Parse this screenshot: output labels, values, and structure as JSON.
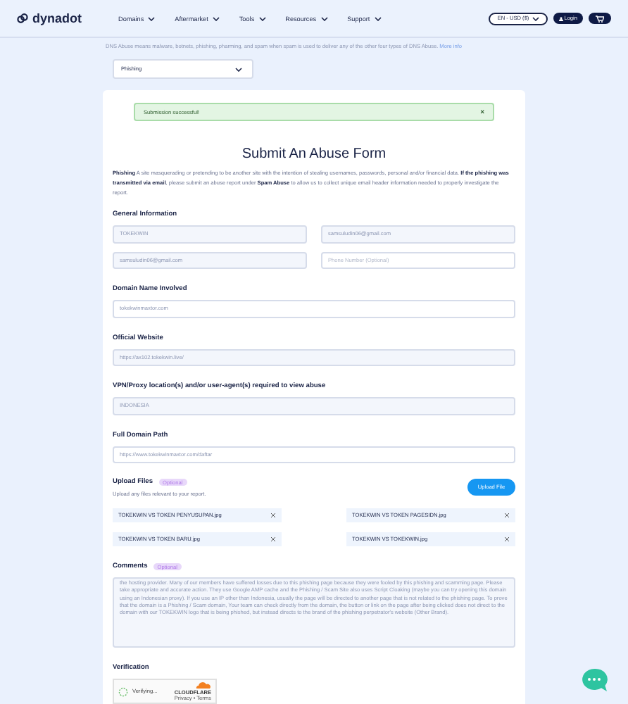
{
  "header": {
    "logo": "dynadot",
    "nav": [
      {
        "label": "Domains"
      },
      {
        "label": "Aftermarket"
      },
      {
        "label": "Tools"
      },
      {
        "label": "Resources"
      },
      {
        "label": "Support"
      }
    ],
    "locale": "EN - USD ($)",
    "login": "Login"
  },
  "notice": {
    "text": "DNS Abuse means malware, botnets, phishing, pharming, and spam when spam is used to deliver any of the other four types of DNS Abuse.",
    "link": "More info"
  },
  "category_select": {
    "value": "Phishing"
  },
  "alert": {
    "text": "Submission successful!",
    "close": "×"
  },
  "form": {
    "title": "Submit An Abuse Form",
    "intro": "**Phishing** A site masquerading or pretending to be another site with the intention of stealing usernames, passwords, personal and/or financial data. **If the phishing was transmitted via email**, please submit an abuse report under **Spam Abuse** to allow us to collect unique email header information needed to properly investigate the report.",
    "general_heading": "General Information",
    "general_fields": [
      {
        "value": "TOKEKWIN",
        "filled": true
      },
      {
        "value": "samsuludin06@gmail.com",
        "filled": true
      },
      {
        "value": "samsuludin06@gmail.com",
        "filled": true
      },
      {
        "placeholder": "Phone Number (Optional)",
        "filled": false
      }
    ],
    "sections": [
      {
        "label": "Domain Name Involved",
        "value": "tokekwinmaxtor.com",
        "filled": false
      },
      {
        "label": "Official Website",
        "value": "https://ax102.tokekwin.live/",
        "filled": true
      },
      {
        "label": "VPN/Proxy location(s) and/or user-agent(s) required to view abuse",
        "value": "INDONESIA",
        "filled": true
      },
      {
        "label": "Full Domain Path",
        "value": "https://www.tokekwinmaxtor.com/daftar",
        "filled": false
      }
    ],
    "upload": {
      "heading": "Upload Files",
      "badge": "Optional",
      "description": "Upload any files relevant to your report.",
      "button": "Upload File",
      "files": [
        {
          "name": "TOKEKWIN VS TOKEN PENYUSUPAN.jpg"
        },
        {
          "name": "TOKEKWIN VS TOKEN PAGESIDN.jpg"
        },
        {
          "name": "TOKEKWIN VS TOKEN BARU.jpg"
        },
        {
          "name": "TOKEKWIN VS TOKEKWIN.jpg"
        }
      ]
    },
    "comments": {
      "heading": "Comments",
      "badge": "Optional",
      "value": "the hosting provider. Many of our members have suffered losses due to this phishing page because they were fooled by this phishing and scamming page. Please take appropriate and accurate action. They use Google AMP cache and the Phishing / Scam Site also uses Script Cloaking (maybe you can try opening this domain using an Indonesian proxy). If you use an IP other than Indonesia, usually the page will be directed to another page that is not related to the phishing page. To prove that the domain is a Phishing / Scam domain, Your team can check directly from the domain, the button or link on the page after being clicked does not direct to the domain with our TOKEKWIN logo that is being phished, but instead directs to the brand of the phishing perpetrator's website (Other Brand)."
    },
    "verification": {
      "heading": "Verification",
      "status": "Verifying...",
      "brand": "CLOUDFLARE",
      "links": "Privacy • Terms"
    }
  }
}
